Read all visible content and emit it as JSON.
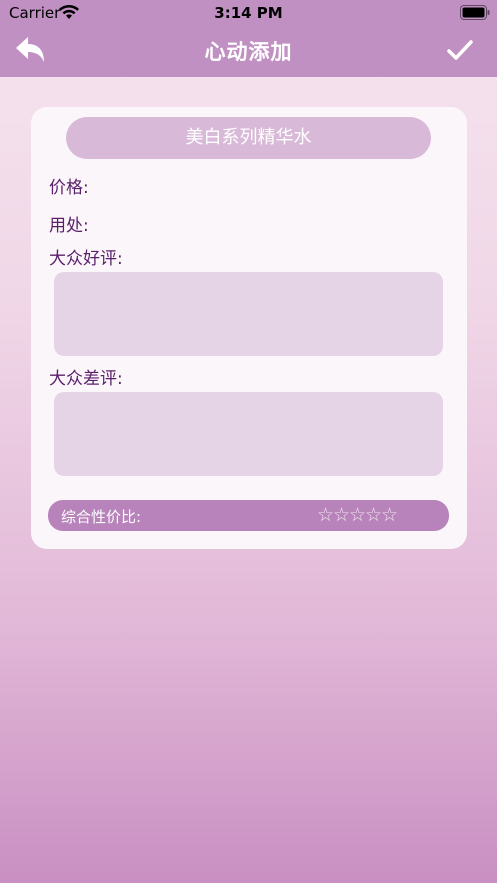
{
  "status_bar": {
    "carrier": "Carrier",
    "time": "3:14 PM"
  },
  "nav": {
    "title": "心动添加",
    "back_icon": "back-arrow-icon",
    "done_icon": "checkmark-icon"
  },
  "form": {
    "product_name": "美白系列精华水",
    "price_label": "价格:",
    "usage_label": "用处:",
    "good_review_label": "大众好评:",
    "good_review_value": "",
    "bad_review_label": "大众差评:",
    "bad_review_value": "",
    "value_label": "综合性价比:",
    "stars": [
      "☆",
      "☆",
      "☆",
      "☆",
      "☆"
    ],
    "rating": 0
  },
  "colors": {
    "nav": "#c190c2",
    "label": "#5a1f6b",
    "pill": "#d8b9d7",
    "rating_bar": "#b783ba"
  }
}
